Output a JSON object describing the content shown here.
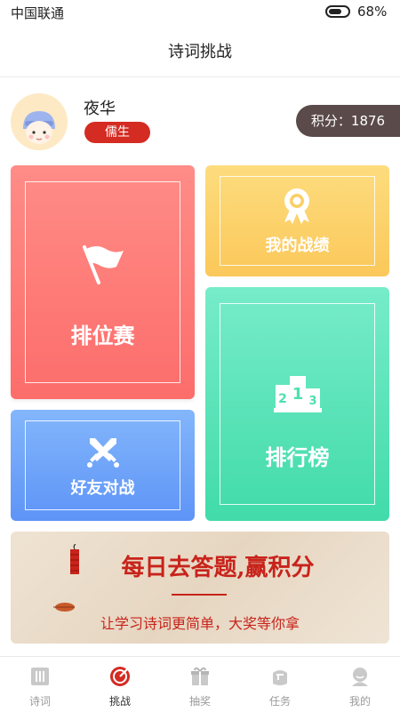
{
  "status_bar": {
    "carrier": "中国联通",
    "battery": "68%"
  },
  "header": {
    "title": "诗词挑战"
  },
  "profile": {
    "name": "夜华",
    "rank": "儒生",
    "points": "积分：1876"
  },
  "cards": {
    "ranked": {
      "label": "排位赛",
      "icon": "flag-icon",
      "color": "#fc7a76"
    },
    "record": {
      "label": "我的战绩",
      "icon": "medal-icon",
      "color": "#fbd06a"
    },
    "friend": {
      "label": "好友对战",
      "icon": "crossed-swords-icon",
      "color": "#6ea3f9"
    },
    "leaderboard": {
      "label": "排行榜",
      "icon": "podium-icon",
      "color": "#52e0b3"
    }
  },
  "banner": {
    "title": "每日去答题,赢积分",
    "subtitle": "让学习诗词更简单，大奖等你拿"
  },
  "tabs": [
    {
      "label": "诗词",
      "icon": "scroll-icon",
      "active": false
    },
    {
      "label": "挑战",
      "icon": "target-icon",
      "active": true
    },
    {
      "label": "抽奖",
      "icon": "gift-icon",
      "active": false
    },
    {
      "label": "任务",
      "icon": "bag-icon",
      "active": false
    },
    {
      "label": "我的",
      "icon": "user-icon",
      "active": false
    }
  ],
  "colors": {
    "accent": "#d42b22",
    "points_bg": "#5a4a49"
  }
}
